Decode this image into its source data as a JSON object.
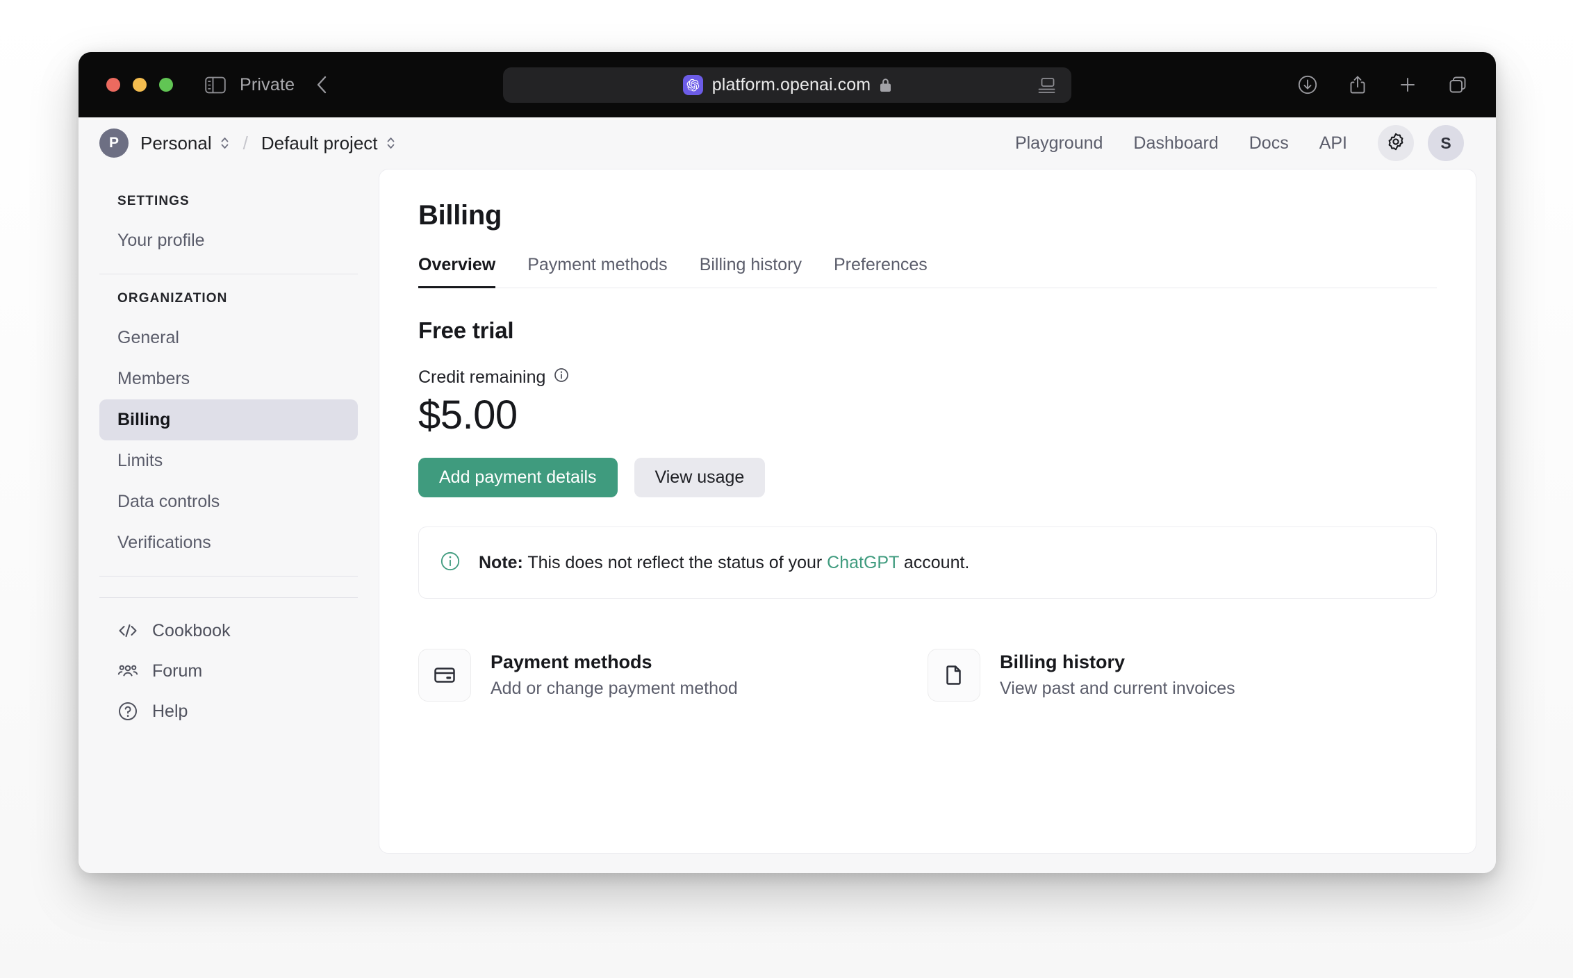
{
  "browser": {
    "profile_label": "Private",
    "url": "platform.openai.com",
    "icons": {
      "sidebar_toggle": "sidebar-toggle-icon",
      "back": "back-chevron-icon",
      "favicon": "openai-favicon",
      "lock": "lock-icon",
      "reader": "reader-view-icon",
      "download": "download-icon",
      "share": "share-icon",
      "new_tab": "plus-icon",
      "tab_overview": "tab-overview-icon"
    }
  },
  "header": {
    "org_initial": "P",
    "org_name": "Personal",
    "separator": "/",
    "project_name": "Default project",
    "nav": [
      {
        "label": "Playground"
      },
      {
        "label": "Dashboard"
      },
      {
        "label": "Docs"
      },
      {
        "label": "API"
      }
    ],
    "settings_icon": "gear-icon",
    "user_initial": "S"
  },
  "sidebar": {
    "settings_heading": "SETTINGS",
    "settings_items": [
      {
        "label": "Your profile",
        "active": false
      }
    ],
    "organization_heading": "ORGANIZATION",
    "organization_items": [
      {
        "label": "General",
        "active": false
      },
      {
        "label": "Members",
        "active": false
      },
      {
        "label": "Billing",
        "active": true
      },
      {
        "label": "Limits",
        "active": false
      },
      {
        "label": "Data controls",
        "active": false
      },
      {
        "label": "Verifications",
        "active": false
      }
    ],
    "footer_links": [
      {
        "label": "Cookbook",
        "icon": "code-brackets-icon"
      },
      {
        "label": "Forum",
        "icon": "people-group-icon"
      },
      {
        "label": "Help",
        "icon": "question-circle-icon"
      }
    ]
  },
  "main": {
    "title": "Billing",
    "tabs": [
      {
        "label": "Overview",
        "active": true
      },
      {
        "label": "Payment methods",
        "active": false
      },
      {
        "label": "Billing history",
        "active": false
      },
      {
        "label": "Preferences",
        "active": false
      }
    ],
    "plan_title": "Free trial",
    "credit_label": "Credit remaining",
    "credit_info_icon": "info-circle-icon",
    "credit_amount": "$5.00",
    "primary_button": "Add payment details",
    "secondary_button": "View usage",
    "note": {
      "icon": "info-circle-icon",
      "bold": "Note:",
      "text_before": " This does not reflect the status of your ",
      "link": "ChatGPT",
      "text_after": " account."
    },
    "cards": [
      {
        "icon": "credit-card-icon",
        "title": "Payment methods",
        "subtitle": "Add or change payment method"
      },
      {
        "icon": "document-icon",
        "title": "Billing history",
        "subtitle": "View past and current invoices"
      }
    ]
  },
  "colors": {
    "accent_green": "#3f9b7e",
    "titlebar": "#0a0a0a",
    "favicon_purple": "#6c5ce7",
    "sidebar_active": "#dfdfe8"
  }
}
